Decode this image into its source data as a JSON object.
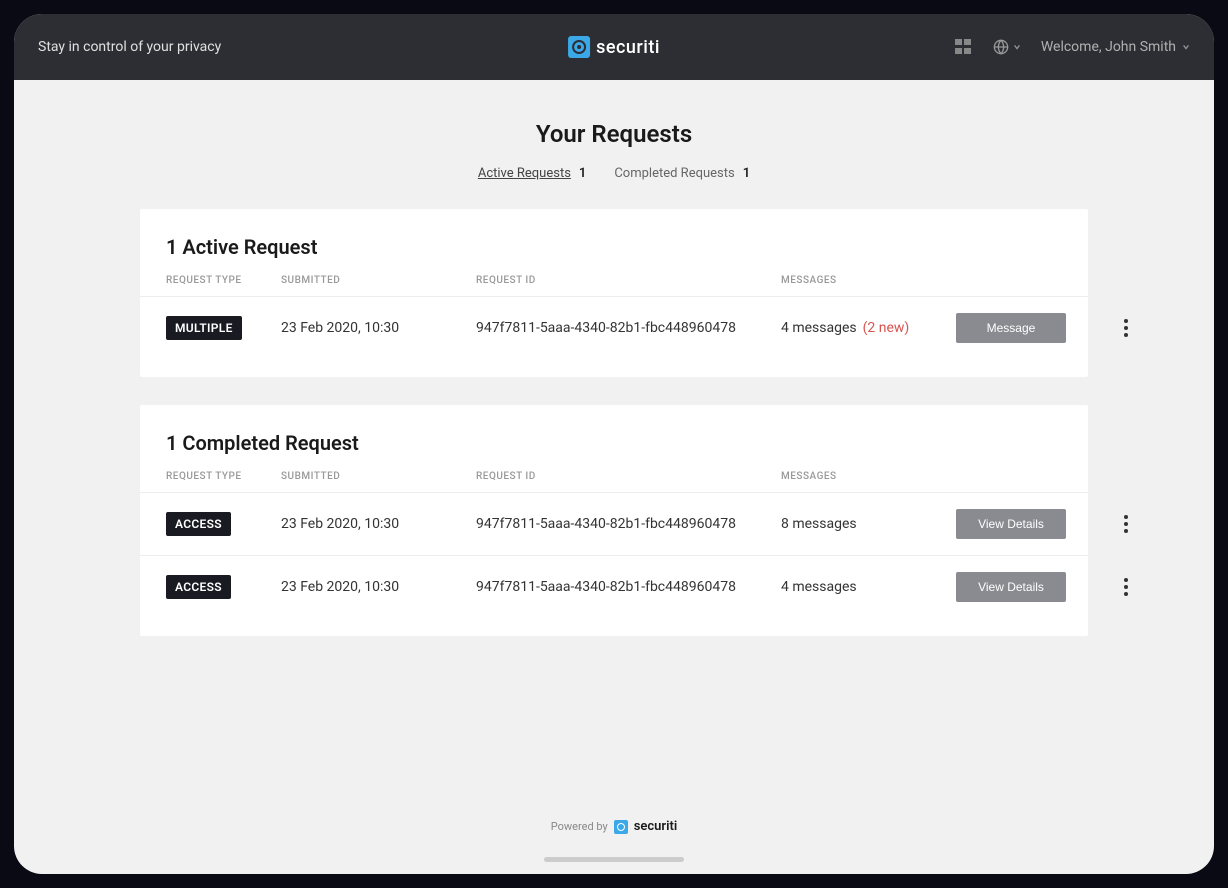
{
  "header": {
    "tagline": "Stay in control of your privacy",
    "brand": "securiti",
    "welcome": "Welcome, John Smith"
  },
  "page": {
    "title": "Your Requests"
  },
  "tabs": {
    "active": {
      "label": "Active Requests",
      "count": "1"
    },
    "completed": {
      "label": "Completed Requests",
      "count": "1"
    }
  },
  "activeSection": {
    "title": "1 Active Request",
    "headers": {
      "type": "REQUEST TYPE",
      "submitted": "SUBMITTED",
      "id": "REQUEST ID",
      "messages": "MESSAGES"
    },
    "rows": [
      {
        "badge": "MULTIPLE",
        "submitted": "23 Feb 2020, 10:30",
        "id": "947f7811-5aaa-4340-82b1-fbc448960478",
        "messages": "4 messages",
        "new": "(2 new)",
        "action": "Message"
      }
    ]
  },
  "completedSection": {
    "title": "1 Completed Request",
    "headers": {
      "type": "REQUEST TYPE",
      "submitted": "SUBMITTED",
      "id": "REQUEST ID",
      "messages": "MESSAGES"
    },
    "rows": [
      {
        "badge": "ACCESS",
        "submitted": "23 Feb 2020, 10:30",
        "id": "947f7811-5aaa-4340-82b1-fbc448960478",
        "messages": "8 messages",
        "action": "View Details"
      },
      {
        "badge": "ACCESS",
        "submitted": "23 Feb 2020, 10:30",
        "id": "947f7811-5aaa-4340-82b1-fbc448960478",
        "messages": "4 messages",
        "action": "View Details"
      }
    ]
  },
  "footer": {
    "powered": "Powered by",
    "brand": "securiti"
  }
}
